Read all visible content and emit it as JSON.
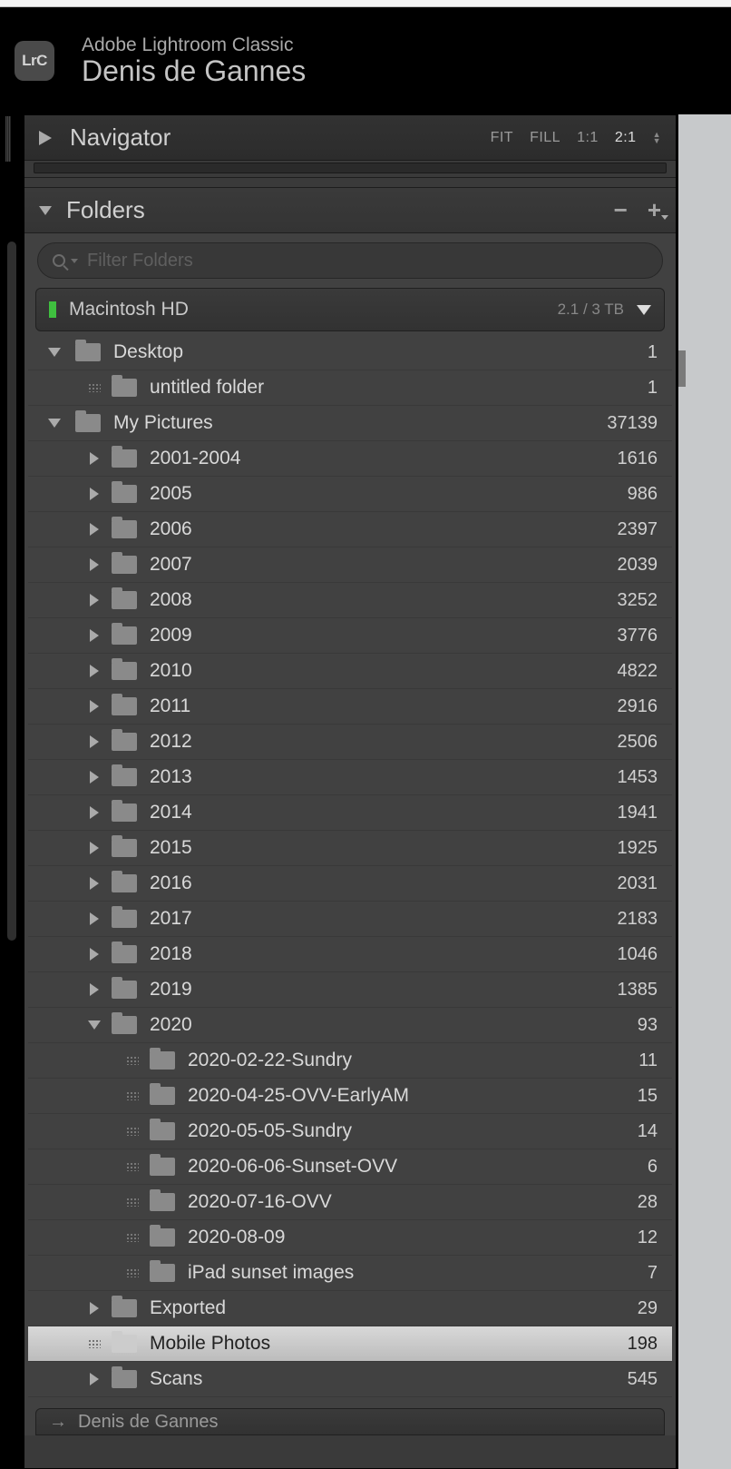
{
  "app": {
    "icon_text": "LrC",
    "title": "Adobe Lightroom Classic",
    "profile": "Denis de Gannes"
  },
  "navigator": {
    "title": "Navigator",
    "zoom": {
      "fit": "FIT",
      "fill": "FILL",
      "one": "1:1",
      "two": "2:1"
    }
  },
  "folders": {
    "title": "Folders",
    "filter_placeholder": "Filter Folders",
    "volume": {
      "name": "Macintosh HD",
      "size": "2.1 / 3 TB"
    },
    "next_volume": "Denis de Gannes",
    "tree": [
      {
        "indent": 0,
        "arrow": "down",
        "name": "Desktop",
        "count": "1"
      },
      {
        "indent": 1,
        "arrow": "dots",
        "name": "untitled folder",
        "count": "1"
      },
      {
        "indent": 0,
        "arrow": "down",
        "name": "My Pictures",
        "count": "37139"
      },
      {
        "indent": 1,
        "arrow": "right",
        "name": "2001-2004",
        "count": "1616"
      },
      {
        "indent": 1,
        "arrow": "right",
        "name": "2005",
        "count": "986"
      },
      {
        "indent": 1,
        "arrow": "right",
        "name": "2006",
        "count": "2397"
      },
      {
        "indent": 1,
        "arrow": "right",
        "name": "2007",
        "count": "2039"
      },
      {
        "indent": 1,
        "arrow": "right",
        "name": "2008",
        "count": "3252"
      },
      {
        "indent": 1,
        "arrow": "right",
        "name": "2009",
        "count": "3776"
      },
      {
        "indent": 1,
        "arrow": "right",
        "name": "2010",
        "count": "4822"
      },
      {
        "indent": 1,
        "arrow": "right",
        "name": "2011",
        "count": "2916"
      },
      {
        "indent": 1,
        "arrow": "right",
        "name": "2012",
        "count": "2506"
      },
      {
        "indent": 1,
        "arrow": "right",
        "name": "2013",
        "count": "1453"
      },
      {
        "indent": 1,
        "arrow": "right",
        "name": "2014",
        "count": "1941"
      },
      {
        "indent": 1,
        "arrow": "right",
        "name": "2015",
        "count": "1925"
      },
      {
        "indent": 1,
        "arrow": "right",
        "name": "2016",
        "count": "2031"
      },
      {
        "indent": 1,
        "arrow": "right",
        "name": "2017",
        "count": "2183"
      },
      {
        "indent": 1,
        "arrow": "right",
        "name": "2018",
        "count": "1046"
      },
      {
        "indent": 1,
        "arrow": "right",
        "name": "2019",
        "count": "1385"
      },
      {
        "indent": 1,
        "arrow": "down",
        "name": "2020",
        "count": "93"
      },
      {
        "indent": 2,
        "arrow": "dots",
        "name": "2020-02-22-Sundry",
        "count": "11"
      },
      {
        "indent": 2,
        "arrow": "dots",
        "name": "2020-04-25-OVV-EarlyAM",
        "count": "15"
      },
      {
        "indent": 2,
        "arrow": "dots",
        "name": "2020-05-05-Sundry",
        "count": "14"
      },
      {
        "indent": 2,
        "arrow": "dots",
        "name": "2020-06-06-Sunset-OVV",
        "count": "6"
      },
      {
        "indent": 2,
        "arrow": "dots",
        "name": "2020-07-16-OVV",
        "count": "28"
      },
      {
        "indent": 2,
        "arrow": "dots",
        "name": "2020-08-09",
        "count": "12"
      },
      {
        "indent": 2,
        "arrow": "dots",
        "name": "iPad sunset images",
        "count": "7"
      },
      {
        "indent": 1,
        "arrow": "right",
        "name": "Exported",
        "count": "29"
      },
      {
        "indent": 1,
        "arrow": "dots",
        "name": "Mobile Photos",
        "count": "198",
        "selected": true
      },
      {
        "indent": 1,
        "arrow": "right",
        "name": "Scans",
        "count": "545"
      }
    ]
  }
}
